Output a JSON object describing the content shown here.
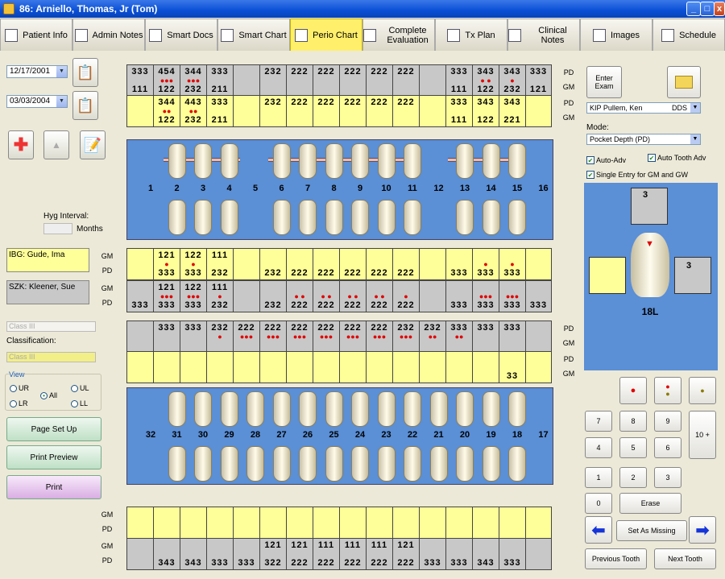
{
  "window": {
    "title": "86: Arniello, Thomas, Jr (Tom)"
  },
  "tabs": [
    {
      "label": "Patient Info",
      "icon": "patient-icon"
    },
    {
      "label": "Admin Notes",
      "icon": "notes-icon"
    },
    {
      "label": "Smart Docs",
      "icon": "docs-icon"
    },
    {
      "label": "Smart Chart",
      "icon": "chart-icon"
    },
    {
      "label": "Perio Chart",
      "icon": "perio-icon",
      "active": true
    },
    {
      "label": "Complete Evaluation",
      "icon": "eval-icon"
    },
    {
      "label": "Tx Plan",
      "icon": "txplan-icon"
    },
    {
      "label": "Clinical Notes",
      "icon": "clinical-icon"
    },
    {
      "label": "Images",
      "icon": "images-icon"
    },
    {
      "label": "Schedule",
      "icon": "schedule-icon"
    }
  ],
  "left": {
    "date1": "12/17/2001",
    "date2": "03/03/2004",
    "hyg_interval_label": "Hyg Interval:",
    "months_label": "Months",
    "hyg_note": "IBG: Gude, Ima",
    "szk_note": "SZK: Kleener, Sue",
    "class_select": "Class III",
    "classification_label": "Classification:",
    "class_select2": "Class III",
    "view_label": "View",
    "view_options": [
      "UR",
      "UL",
      "All",
      "LR",
      "LL"
    ],
    "view_selected": "All",
    "page_setup": "Page Set Up",
    "print_preview": "Print Preview",
    "print": "Print"
  },
  "row_labels": {
    "pd": "PD",
    "gm": "GM"
  },
  "upper_numbers": [
    "1",
    "2",
    "3",
    "4",
    "5",
    "6",
    "7",
    "8",
    "9",
    "10",
    "11",
    "12",
    "13",
    "14",
    "15",
    "16"
  ],
  "lower_numbers": [
    "32",
    "31",
    "30",
    "29",
    "28",
    "27",
    "26",
    "25",
    "24",
    "23",
    "22",
    "21",
    "20",
    "19",
    "18",
    "17"
  ],
  "upper_rows": [
    {
      "label": "PD",
      "cells": [
        {
          "c": "g",
          "t1": "333"
        },
        {
          "c": "g",
          "t1": "454",
          "r": "454"
        },
        {
          "c": "g",
          "t1": "344",
          "r": "344"
        },
        {
          "c": "g",
          "t1": "333"
        },
        {
          "c": "g"
        },
        {
          "c": "g",
          "t1": "232"
        },
        {
          "c": "g",
          "t1": "222"
        },
        {
          "c": "g",
          "t1": "222"
        },
        {
          "c": "g",
          "t1": "222"
        },
        {
          "c": "g",
          "t1": "222"
        },
        {
          "c": "g",
          "t1": "222"
        },
        {
          "c": "g"
        },
        {
          "c": "g",
          "t1": "333"
        },
        {
          "c": "g",
          "t1": "343",
          "r": "4"
        },
        {
          "c": "g",
          "t1": "343",
          "r": "4"
        },
        {
          "c": "g",
          "t1": "333"
        }
      ]
    },
    {
      "label": "GM",
      "cells": [
        {
          "c": "g",
          "t2": "111"
        },
        {
          "c": "g",
          "t2": "122",
          "d": "●●●"
        },
        {
          "c": "g",
          "t2": "232",
          "d": "●●●"
        },
        {
          "c": "g",
          "t2": "211"
        },
        {
          "c": "g"
        },
        {
          "c": "g"
        },
        {
          "c": "g"
        },
        {
          "c": "g"
        },
        {
          "c": "g"
        },
        {
          "c": "g"
        },
        {
          "c": "g"
        },
        {
          "c": "g"
        },
        {
          "c": "g",
          "t2": "111"
        },
        {
          "c": "g",
          "t2": "122",
          "d": "● ●"
        },
        {
          "c": "g",
          "t2": "232",
          "d": "●"
        },
        {
          "c": "g",
          "t2": "121"
        }
      ]
    },
    {
      "label": "PD",
      "cells": [
        {
          "c": "y"
        },
        {
          "c": "y",
          "t1": "344",
          "r": "44"
        },
        {
          "c": "y",
          "t1": "443",
          "r": "44"
        },
        {
          "c": "y",
          "t1": "333"
        },
        {
          "c": "y"
        },
        {
          "c": "y",
          "t1": "232"
        },
        {
          "c": "y",
          "t1": "222"
        },
        {
          "c": "y",
          "t1": "222"
        },
        {
          "c": "y",
          "t1": "222"
        },
        {
          "c": "y",
          "t1": "222"
        },
        {
          "c": "y",
          "t1": "222"
        },
        {
          "c": "y"
        },
        {
          "c": "y",
          "t1": "333"
        },
        {
          "c": "y",
          "t1": "343"
        },
        {
          "c": "y",
          "t1": "343"
        },
        {
          "c": "y"
        }
      ]
    },
    {
      "label": "GM",
      "cells": [
        {
          "c": "y"
        },
        {
          "c": "y",
          "t2": "122",
          "d": "●●"
        },
        {
          "c": "y",
          "t2": "232",
          "d": "●●"
        },
        {
          "c": "y",
          "t2": "211"
        },
        {
          "c": "y"
        },
        {
          "c": "y"
        },
        {
          "c": "y"
        },
        {
          "c": "y"
        },
        {
          "c": "y"
        },
        {
          "c": "y"
        },
        {
          "c": "y"
        },
        {
          "c": "y"
        },
        {
          "c": "y",
          "t2": "111"
        },
        {
          "c": "y",
          "t2": "122"
        },
        {
          "c": "y",
          "t2": "221"
        },
        {
          "c": "y"
        }
      ]
    }
  ],
  "mid_rows": [
    {
      "label": "GM",
      "cells": [
        {
          "c": "y"
        },
        {
          "c": "y",
          "t1": "121",
          "d": "●"
        },
        {
          "c": "y",
          "t1": "122",
          "d": "●"
        },
        {
          "c": "y",
          "t1": "111"
        },
        {
          "c": "y"
        },
        {
          "c": "y"
        },
        {
          "c": "y"
        },
        {
          "c": "y"
        },
        {
          "c": "y"
        },
        {
          "c": "y"
        },
        {
          "c": "y"
        },
        {
          "c": "y"
        },
        {
          "c": "y"
        },
        {
          "c": "y",
          "d": "●"
        },
        {
          "c": "y",
          "d": "●"
        },
        {
          "c": "y"
        }
      ]
    },
    {
      "label": "PD",
      "cells": [
        {
          "c": "y"
        },
        {
          "c": "y",
          "t2": "333"
        },
        {
          "c": "y",
          "t2": "333"
        },
        {
          "c": "y",
          "t2": "232"
        },
        {
          "c": "y"
        },
        {
          "c": "y",
          "t2": "232"
        },
        {
          "c": "y",
          "t2": "222"
        },
        {
          "c": "y",
          "t2": "222"
        },
        {
          "c": "y",
          "t2": "222"
        },
        {
          "c": "y",
          "t2": "222"
        },
        {
          "c": "y",
          "t2": "222"
        },
        {
          "c": "y"
        },
        {
          "c": "y",
          "t2": "333"
        },
        {
          "c": "y",
          "t2": "333"
        },
        {
          "c": "y",
          "t2": "333"
        },
        {
          "c": "y"
        }
      ]
    },
    {
      "label": "GM",
      "cells": [
        {
          "c": "g"
        },
        {
          "c": "g",
          "t1": "121",
          "d": "●●●"
        },
        {
          "c": "g",
          "t1": "122",
          "d": "●●●"
        },
        {
          "c": "g",
          "t1": "111",
          "d": "●"
        },
        {
          "c": "g"
        },
        {
          "c": "g"
        },
        {
          "c": "g",
          "d": "● ●"
        },
        {
          "c": "g",
          "d": "● ●"
        },
        {
          "c": "g",
          "d": "● ●"
        },
        {
          "c": "g",
          "d": "● ●"
        },
        {
          "c": "g",
          "d": "●"
        },
        {
          "c": "g"
        },
        {
          "c": "g"
        },
        {
          "c": "g",
          "d": "●●●"
        },
        {
          "c": "g",
          "d": "●●●"
        },
        {
          "c": "g"
        }
      ]
    },
    {
      "label": "PD",
      "cells": [
        {
          "c": "g",
          "t2": "333"
        },
        {
          "c": "g",
          "t2": "333"
        },
        {
          "c": "g",
          "t2": "333"
        },
        {
          "c": "g",
          "t2": "232"
        },
        {
          "c": "g"
        },
        {
          "c": "g",
          "t2": "232"
        },
        {
          "c": "g",
          "t2": "222"
        },
        {
          "c": "g",
          "t2": "222"
        },
        {
          "c": "g",
          "t2": "222"
        },
        {
          "c": "g",
          "t2": "222"
        },
        {
          "c": "g",
          "t2": "222"
        },
        {
          "c": "g"
        },
        {
          "c": "g",
          "t2": "333"
        },
        {
          "c": "g",
          "t2": "333"
        },
        {
          "c": "g",
          "t2": "333"
        },
        {
          "c": "g",
          "t2": "333"
        }
      ]
    }
  ],
  "lower_top_rows": [
    {
      "label": "PD",
      "cells": [
        {
          "c": "g"
        },
        {
          "c": "g",
          "t1": "333"
        },
        {
          "c": "g",
          "t1": "333"
        },
        {
          "c": "g",
          "t1": "232"
        },
        {
          "c": "g",
          "t1": "222"
        },
        {
          "c": "g",
          "t1": "222"
        },
        {
          "c": "g",
          "t1": "222"
        },
        {
          "c": "g",
          "t1": "222"
        },
        {
          "c": "g",
          "t1": "222"
        },
        {
          "c": "g",
          "t1": "222"
        },
        {
          "c": "g",
          "t1": "232"
        },
        {
          "c": "g",
          "t1": "232"
        },
        {
          "c": "g",
          "t1": "333"
        },
        {
          "c": "g",
          "t1": "333"
        },
        {
          "c": "g",
          "t1": "333"
        },
        {
          "c": "g"
        }
      ]
    },
    {
      "label": "GM",
      "cells": [
        {
          "c": "g"
        },
        {
          "c": "g"
        },
        {
          "c": "g"
        },
        {
          "c": "g",
          "d": "●"
        },
        {
          "c": "g",
          "d": "●●●"
        },
        {
          "c": "g",
          "d": "●●●"
        },
        {
          "c": "g",
          "d": "●●●"
        },
        {
          "c": "g",
          "d": "●●●"
        },
        {
          "c": "g",
          "d": "●●●"
        },
        {
          "c": "g",
          "d": "●●●"
        },
        {
          "c": "g",
          "d": "●●●"
        },
        {
          "c": "g",
          "d": "●●"
        },
        {
          "c": "g",
          "d": "●●"
        },
        {
          "c": "g"
        },
        {
          "c": "g"
        },
        {
          "c": "g"
        }
      ]
    },
    {
      "label": "PD",
      "cells": [
        {
          "c": "y"
        },
        {
          "c": "y"
        },
        {
          "c": "y"
        },
        {
          "c": "y"
        },
        {
          "c": "y"
        },
        {
          "c": "y"
        },
        {
          "c": "y"
        },
        {
          "c": "y"
        },
        {
          "c": "y"
        },
        {
          "c": "y"
        },
        {
          "c": "y"
        },
        {
          "c": "y"
        },
        {
          "c": "y"
        },
        {
          "c": "y"
        },
        {
          "c": "y",
          "t2": "33"
        },
        {
          "c": "y"
        }
      ]
    },
    {
      "label": "GM",
      "cells": [
        {
          "c": "y"
        },
        {
          "c": "y"
        },
        {
          "c": "y"
        },
        {
          "c": "y"
        },
        {
          "c": "y"
        },
        {
          "c": "y"
        },
        {
          "c": "y"
        },
        {
          "c": "y"
        },
        {
          "c": "y"
        },
        {
          "c": "y"
        },
        {
          "c": "y"
        },
        {
          "c": "y"
        },
        {
          "c": "y"
        },
        {
          "c": "y"
        },
        {
          "c": "y"
        },
        {
          "c": "y"
        }
      ]
    }
  ],
  "bottom_rows": [
    {
      "label": "GM",
      "cells": [
        {
          "c": "y"
        },
        {
          "c": "y"
        },
        {
          "c": "y"
        },
        {
          "c": "y"
        },
        {
          "c": "y"
        },
        {
          "c": "y"
        },
        {
          "c": "y"
        },
        {
          "c": "y"
        },
        {
          "c": "y"
        },
        {
          "c": "y"
        },
        {
          "c": "y"
        },
        {
          "c": "y"
        },
        {
          "c": "y"
        },
        {
          "c": "y"
        },
        {
          "c": "y"
        },
        {
          "c": "y"
        }
      ]
    },
    {
      "label": "PD",
      "cells": [
        {
          "c": "y"
        },
        {
          "c": "y"
        },
        {
          "c": "y"
        },
        {
          "c": "y"
        },
        {
          "c": "y"
        },
        {
          "c": "y"
        },
        {
          "c": "y"
        },
        {
          "c": "y"
        },
        {
          "c": "y"
        },
        {
          "c": "y"
        },
        {
          "c": "y"
        },
        {
          "c": "y"
        },
        {
          "c": "y"
        },
        {
          "c": "y"
        },
        {
          "c": "y"
        },
        {
          "c": "y"
        }
      ]
    },
    {
      "label": "GM",
      "cells": [
        {
          "c": "g"
        },
        {
          "c": "g"
        },
        {
          "c": "g"
        },
        {
          "c": "g"
        },
        {
          "c": "g"
        },
        {
          "c": "g",
          "t1": "121"
        },
        {
          "c": "g",
          "t1": "121"
        },
        {
          "c": "g",
          "t1": "111"
        },
        {
          "c": "g",
          "t1": "111"
        },
        {
          "c": "g",
          "t1": "111"
        },
        {
          "c": "g",
          "t1": "121"
        },
        {
          "c": "g"
        },
        {
          "c": "g"
        },
        {
          "c": "g"
        },
        {
          "c": "g"
        },
        {
          "c": "g"
        }
      ]
    },
    {
      "label": "PD",
      "cells": [
        {
          "c": "g"
        },
        {
          "c": "g",
          "t2": "343"
        },
        {
          "c": "g",
          "t2": "343"
        },
        {
          "c": "g",
          "t2": "333"
        },
        {
          "c": "g",
          "t2": "333"
        },
        {
          "c": "g",
          "t2": "322"
        },
        {
          "c": "g",
          "t2": "222"
        },
        {
          "c": "g",
          "t2": "222"
        },
        {
          "c": "g",
          "t2": "222"
        },
        {
          "c": "g",
          "t2": "222"
        },
        {
          "c": "g",
          "t2": "222"
        },
        {
          "c": "g",
          "t2": "333"
        },
        {
          "c": "g",
          "t2": "333"
        },
        {
          "c": "g",
          "t2": "343"
        },
        {
          "c": "g",
          "t2": "333"
        },
        {
          "c": "g"
        }
      ]
    }
  ],
  "right": {
    "enter_exam": "Enter Exam",
    "provider": "KIP    Pullem, Ken",
    "provider_suffix": "DDS",
    "mode_label": "Mode:",
    "mode": "Pocket Depth (PD)",
    "auto_adv": "Auto-Adv",
    "auto_tooth_adv": "Auto Tooth Adv",
    "single_entry": "Single Entry for GM and GW",
    "tooth_top_val": "3",
    "tooth_right_val": "3",
    "tooth_label": "18L",
    "keys": [
      "7",
      "8",
      "9",
      "4",
      "5",
      "6",
      "1",
      "2",
      "3",
      "0"
    ],
    "key_10": "10 +",
    "erase": "Erase",
    "set_missing": "Set As Missing",
    "prev_tooth": "Previous Tooth",
    "next_tooth": "Next Tooth"
  }
}
